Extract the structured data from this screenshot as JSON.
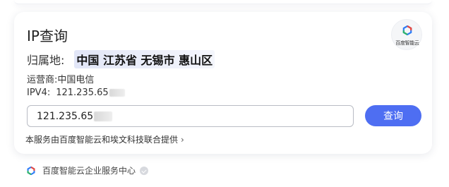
{
  "card": {
    "title": "IP查询",
    "logo_text": "百度智能云",
    "location_label": "归属地:",
    "location_value": "中国 江苏省 无锡市 惠山区",
    "carrier_label": "运营商:",
    "carrier_value": "中国电信",
    "ipv4_label": "IPV4:",
    "ipv4_value": "121.235.65",
    "input_value": "121.235.65",
    "search_button": "查询",
    "provider_link": "本服务由百度智能云和埃文科技联合提供",
    "provider_chevron": "›"
  },
  "service": {
    "name": "百度智能云企业服务中心"
  },
  "colors": {
    "accent": "#4e6ef2",
    "highlight": "#e6eaf8"
  },
  "icons": {
    "logo": "baidu-cloud-logo-icon",
    "service": "baidu-cloud-small-icon",
    "verify": "verified-badge-icon",
    "chevron": "chevron-right-icon"
  }
}
